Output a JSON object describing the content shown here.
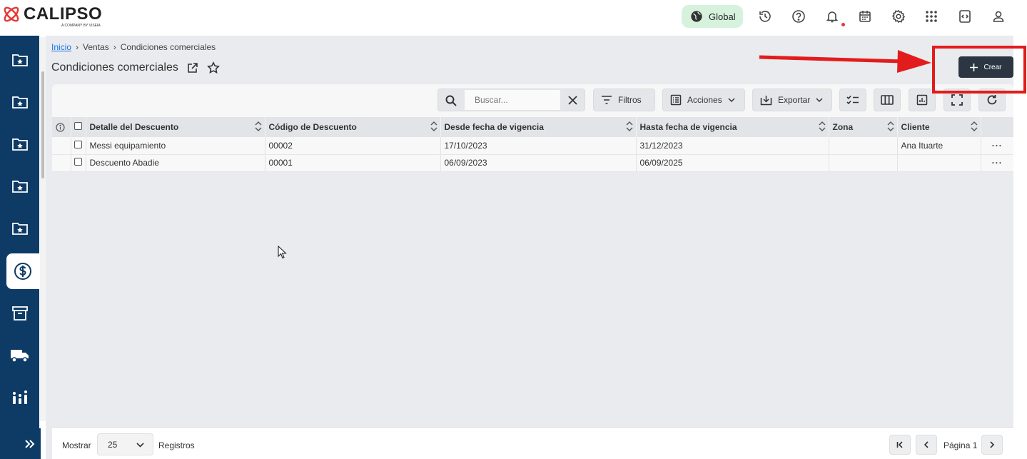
{
  "app": {
    "brand": "CALIPSO",
    "brand_sub": "A COMPANY BY VISEIA",
    "scope_label": "Global"
  },
  "colors": {
    "sidebar": "#0d3b66",
    "accent_pill": "#d6f2dd",
    "primary_button": "#2b3642",
    "annotation": "#e21c1c"
  },
  "topbar_icons": [
    "globe-icon",
    "history-icon",
    "help-icon",
    "bell-icon",
    "calendar-icon",
    "settings-icon",
    "apps-grid-icon",
    "code-window-icon",
    "user-icon"
  ],
  "sidebar_icons": [
    "folder-star-icon",
    "folder-star-icon",
    "folder-star-icon",
    "folder-star-icon",
    "folder-star-icon",
    "dollar-icon",
    "archive-icon",
    "truck-icon",
    "chart-icon",
    "expand-icon"
  ],
  "breadcrumb": {
    "home": "Inicio",
    "section": "Ventas",
    "current": "Condiciones comerciales"
  },
  "page": {
    "title": "Condiciones comerciales",
    "create_label": "Crear"
  },
  "toolbar": {
    "search_placeholder": "Buscar...",
    "filters_label": "Filtros",
    "actions_label": "Acciones",
    "export_label": "Exportar"
  },
  "table": {
    "columns": [
      "Detalle del Descuento",
      "Código de Descuento",
      "Desde fecha de vigencia",
      "Hasta fecha de vigencia",
      "Zona",
      "Cliente"
    ],
    "rows": [
      {
        "detalle": "Messi equipamiento",
        "codigo": "00002",
        "desde": "17/10/2023",
        "hasta": "31/12/2023",
        "zona": "",
        "cliente": "Ana Ituarte"
      },
      {
        "detalle": "Descuento Abadie",
        "codigo": "00001",
        "desde": "06/09/2023",
        "hasta": "06/09/2025",
        "zona": "",
        "cliente": ""
      }
    ],
    "row_menu": "···"
  },
  "footer": {
    "show_label": "Mostrar",
    "page_size": "25",
    "records_label": "Registros",
    "page_label": "Página 1"
  }
}
